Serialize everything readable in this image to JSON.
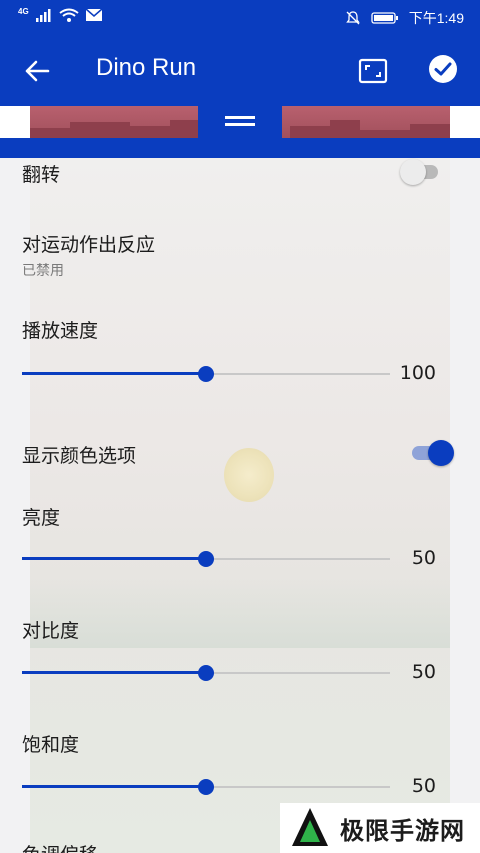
{
  "status_bar": {
    "network": "4G",
    "time": "下午1:49"
  },
  "toolbar": {
    "title": "Dino Run",
    "back_icon": "arrow-left-icon",
    "fullscreen_icon": "fullscreen-icon",
    "confirm_icon": "check-circle-icon"
  },
  "settings": {
    "flip": {
      "label": "翻转",
      "enabled": false
    },
    "motion": {
      "label": "对运动作出反应",
      "subtitle": "已禁用"
    },
    "playback_speed": {
      "label": "播放速度",
      "value": "100",
      "fraction": 0.5
    },
    "color_options": {
      "label": "显示颜色选项",
      "enabled": true
    },
    "brightness": {
      "label": "亮度",
      "value": "50",
      "fraction": 0.5
    },
    "contrast": {
      "label": "对比度",
      "value": "50",
      "fraction": 0.5
    },
    "saturation": {
      "label": "饱和度",
      "value": "50",
      "fraction": 0.5
    },
    "hue_shift": {
      "label": "色调偏移"
    }
  },
  "watermark": {
    "text": "极限手游网"
  },
  "colors": {
    "primary": "#0a3dbf",
    "rail": "#c8c8c8",
    "background": "#f2f2f3"
  }
}
